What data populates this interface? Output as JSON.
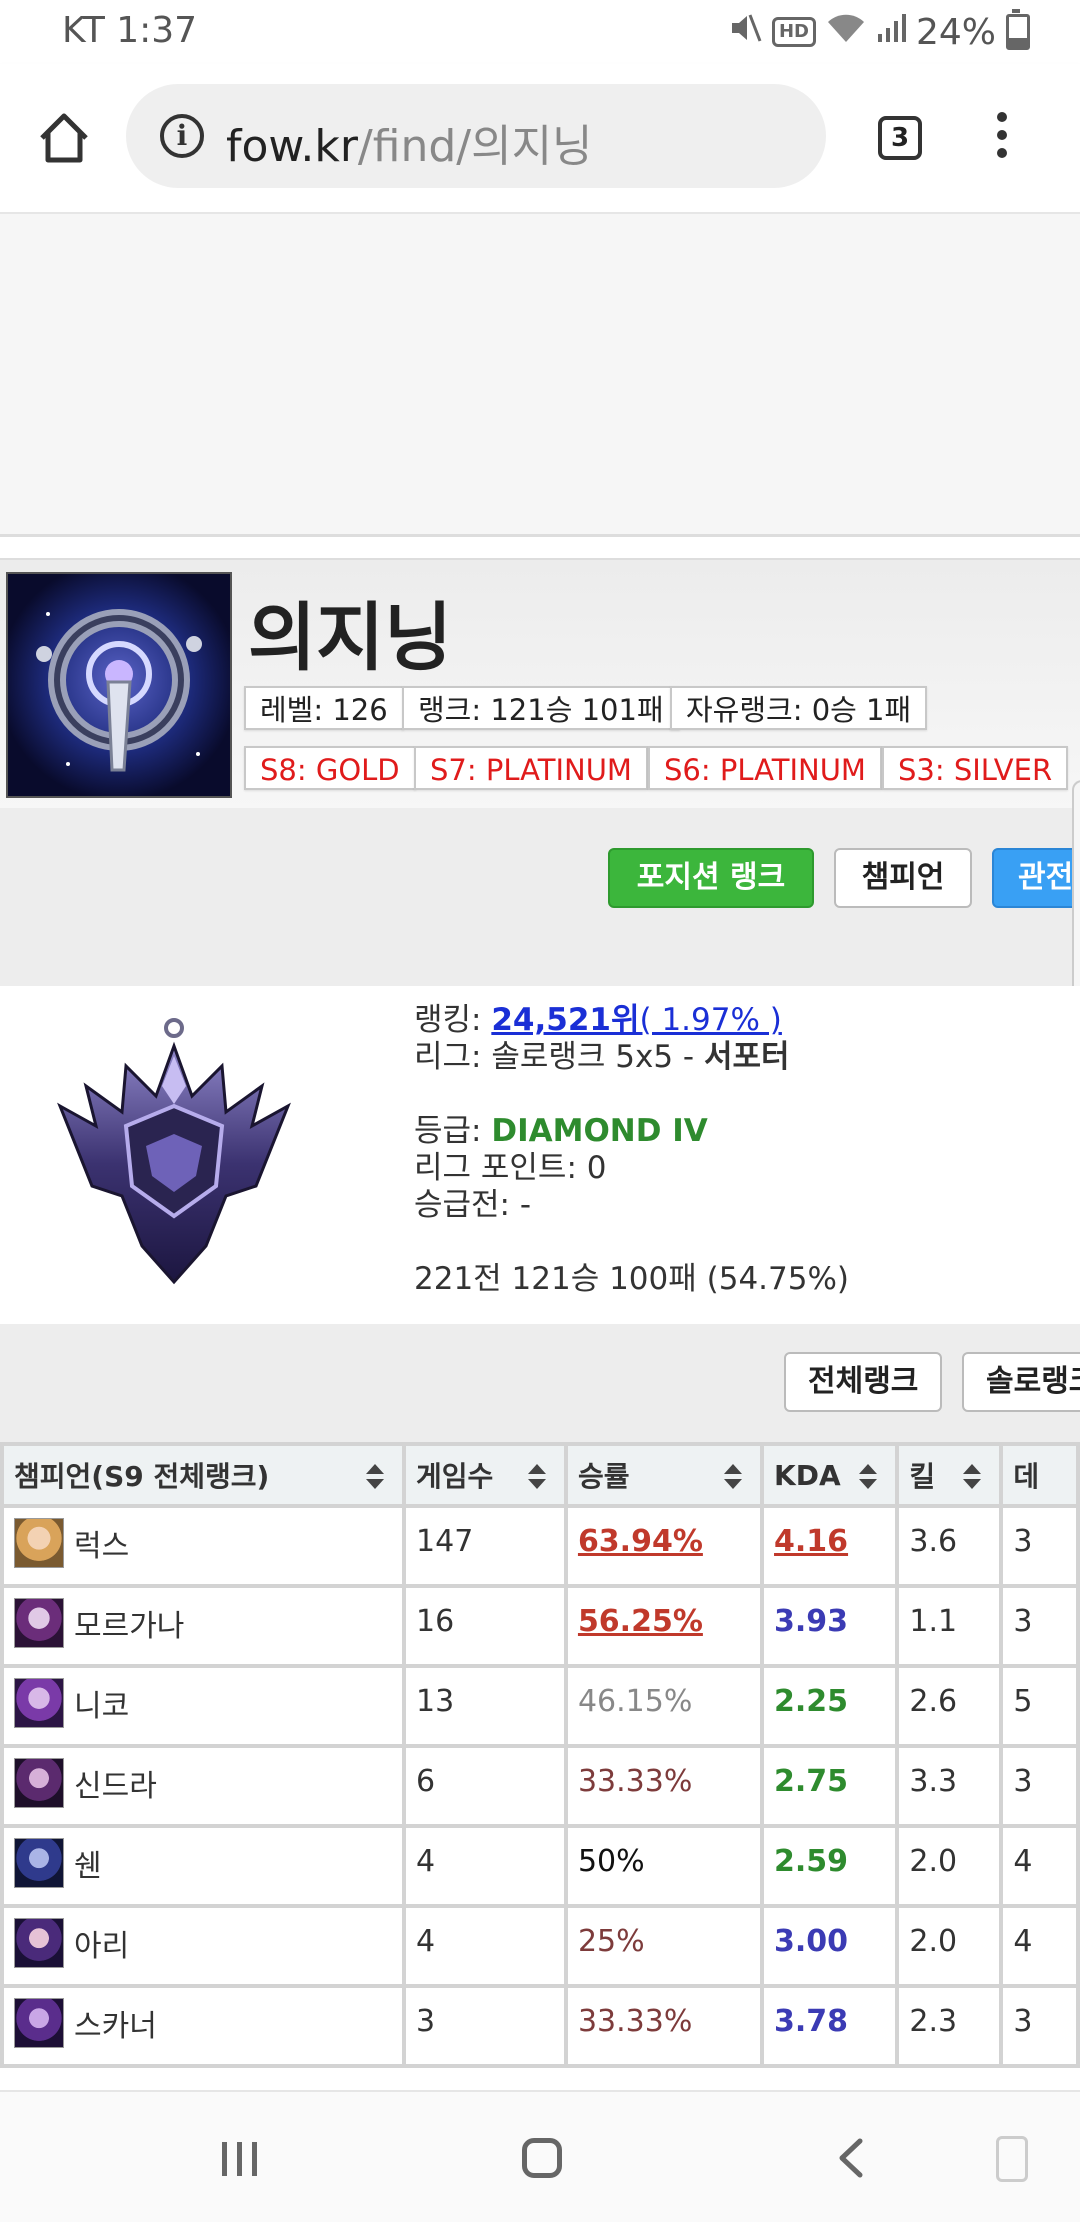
{
  "status_bar": {
    "time": "KT 1:37",
    "battery": "24%",
    "hd": "HD"
  },
  "browser": {
    "url_domain": "fow.kr",
    "url_path": "/find/의지닝",
    "tab_count": "3"
  },
  "profile": {
    "name": "의지닝",
    "tags": [
      "레벨: 126",
      "랭크: 121승 101패",
      "자유랭크: 0승 1패"
    ],
    "season_tags": [
      "S8: GOLD",
      "S7: PLATINUM",
      "S6: PLATINUM",
      "S3: SILVER"
    ]
  },
  "actions": {
    "position_rank": "포지션 랭크",
    "champion": "챔피언",
    "spectate": "관전"
  },
  "rank": {
    "ranking_label": "랭킹: ",
    "ranking_value": "24,521위",
    "ranking_pct": "( 1.97% )",
    "league_label": "리그: 솔로랭크 5x5 - ",
    "league_position": "서포터",
    "tier_label": "등급: ",
    "tier_value": "DIAMOND IV",
    "lp": "리그 포인트: 0",
    "promo": "승급전: -",
    "record": "221전 121승 100패 (54.75%)"
  },
  "filters": {
    "all_rank": "전체랭크",
    "solo_rank": "솔로랭크"
  },
  "table": {
    "headers": {
      "champion": "챔피언(S9 전체랭크)",
      "games": "게임수",
      "winrate": "승률",
      "kda": "KDA",
      "kills": "킬",
      "deaths": "데"
    },
    "rows": [
      {
        "name": "럭스",
        "games": "147",
        "winrate": "63.94%",
        "kda": "4.16",
        "kills": "3.6",
        "deaths": "3"
      },
      {
        "name": "모르가나",
        "games": "16",
        "winrate": "56.25%",
        "kda": "3.93",
        "kills": "1.1",
        "deaths": "3"
      },
      {
        "name": "니코",
        "games": "13",
        "winrate": "46.15%",
        "kda": "2.25",
        "kills": "2.6",
        "deaths": "5"
      },
      {
        "name": "신드라",
        "games": "6",
        "winrate": "33.33%",
        "kda": "2.75",
        "kills": "3.3",
        "deaths": "3"
      },
      {
        "name": "쉔",
        "games": "4",
        "winrate": "50%",
        "kda": "2.59",
        "kills": "2.0",
        "deaths": "4"
      },
      {
        "name": "아리",
        "games": "4",
        "winrate": "25%",
        "kda": "3.00",
        "kills": "2.0",
        "deaths": "4"
      },
      {
        "name": "스카너",
        "games": "3",
        "winrate": "33.33%",
        "kda": "3.78",
        "kills": "2.3",
        "deaths": "3"
      }
    ]
  },
  "colors": {
    "green_button": "#3cb63c",
    "blue_button": "#39a0f4",
    "season_red": "#e01b1b",
    "link_blue": "#1a2fd6",
    "tier_green": "#2e8b2e"
  }
}
